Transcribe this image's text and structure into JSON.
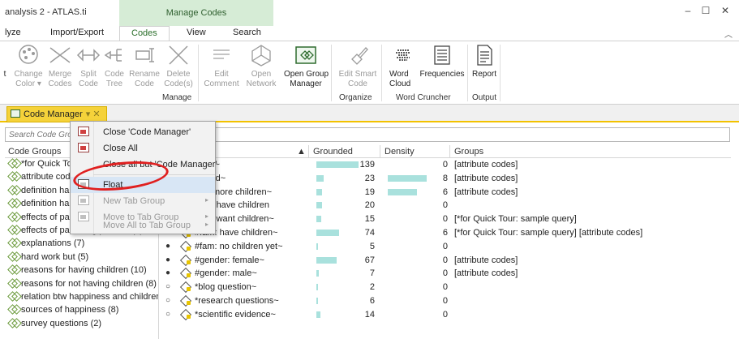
{
  "window": {
    "title": "analysis 2 - ATLAS.ti",
    "context_tab": "Manage Codes",
    "minimize": "–",
    "maximize": "☐",
    "close": "✕"
  },
  "ribbon_tabs": [
    {
      "label": "lyze"
    },
    {
      "label": "Import/Export"
    },
    {
      "label": "Codes"
    },
    {
      "label": "View"
    },
    {
      "label": "Search"
    }
  ],
  "ribbon": {
    "buttons": [
      {
        "label": "t",
        "label2": ""
      },
      {
        "label": "Change",
        "label2": "Color ▾"
      },
      {
        "label": "Merge",
        "label2": "Codes"
      },
      {
        "label": "Split",
        "label2": "Code"
      },
      {
        "label": "Code",
        "label2": "Tree"
      },
      {
        "label": "Rename",
        "label2": "Code"
      },
      {
        "label": "Delete",
        "label2": "Code(s)"
      },
      {
        "label": "Edit",
        "label2": "Comment"
      },
      {
        "label": "Open",
        "label2": "Network"
      },
      {
        "label": "Open Group",
        "label2": "Manager"
      },
      {
        "label": "Edit Smart",
        "label2": "Code"
      },
      {
        "label": "Word",
        "label2": "Cloud"
      },
      {
        "label": "Frequencies",
        "label2": ""
      },
      {
        "label": "Report",
        "label2": ""
      }
    ],
    "groups": [
      "Manage",
      "Organize",
      "Word Cruncher",
      "Output"
    ]
  },
  "doc_tab": {
    "label": "Code Manager",
    "actions": "▾ ✕"
  },
  "search": {
    "placeholder": "Search Code Group"
  },
  "left_pane": {
    "header": "Code Groups",
    "items": [
      "*for Quick Tour",
      "attribute codes",
      "definition happ",
      "definition happ",
      "effects of paren",
      "effects of parenting positive (7)",
      "explanations (7)",
      "hard work but (5)",
      "reasons for having children (10)",
      "reasons for not having children (8)",
      "relation btw happiness and children",
      "sources of happiness (8)",
      "survey questions (2)"
    ]
  },
  "table": {
    "headers": {
      "sort": "▲",
      "grounded": "Grounded",
      "density": "Density",
      "groups": "Groups"
    },
    "rows": [
      {
        "bullet": "",
        "name": "entry~",
        "grounded": 139,
        "gbar": 1.0,
        "density": 0,
        "dbar": 0,
        "groups": "[attribute codes]"
      },
      {
        "bullet": "",
        "name": "1 child~",
        "grounded": 23,
        "gbar": 0.17,
        "density": 8,
        "dbar": 1.0,
        "groups": "[attribute codes]"
      },
      {
        "bullet": "",
        "name": "2 or more  children~",
        "grounded": 19,
        "gbar": 0.14,
        "density": 6,
        "dbar": 0.75,
        "groups": "[attribute codes]"
      },
      {
        "bullet": "",
        "name": "don't have children",
        "grounded": 20,
        "gbar": 0.14,
        "density": 0,
        "dbar": 0,
        "groups": ""
      },
      {
        "bullet": "",
        "name": "don't want children~",
        "grounded": 15,
        "gbar": 0.11,
        "density": 0,
        "dbar": 0,
        "groups": "[*for Quick Tour: sample query]"
      },
      {
        "bullet": "●",
        "name": "#fam: have children~",
        "grounded": 74,
        "gbar": 0.53,
        "density": 6,
        "dbar": 0,
        "groups": "[*for Quick Tour: sample query] [attribute codes]"
      },
      {
        "bullet": "●",
        "name": "#fam: no children yet~",
        "grounded": 5,
        "gbar": 0.04,
        "density": 0,
        "dbar": 0,
        "groups": ""
      },
      {
        "bullet": "●",
        "name": "#gender: female~",
        "grounded": 67,
        "gbar": 0.48,
        "density": 0,
        "dbar": 0,
        "groups": "[attribute codes]"
      },
      {
        "bullet": "●",
        "name": "#gender: male~",
        "grounded": 7,
        "gbar": 0.05,
        "density": 0,
        "dbar": 0,
        "groups": "[attribute codes]"
      },
      {
        "bullet": "○",
        "name": "*blog question~",
        "grounded": 2,
        "gbar": 0.015,
        "density": 0,
        "dbar": 0,
        "groups": ""
      },
      {
        "bullet": "○",
        "name": "*research questions~",
        "grounded": 6,
        "gbar": 0.045,
        "density": 0,
        "dbar": 0,
        "groups": ""
      },
      {
        "bullet": "○",
        "name": "*scientific evidence~",
        "grounded": 14,
        "gbar": 0.1,
        "density": 0,
        "dbar": 0,
        "groups": ""
      }
    ]
  },
  "context_menu": {
    "items": [
      {
        "label": "Close 'Code Manager'",
        "disabled": false
      },
      {
        "label": "Close All",
        "disabled": false
      },
      {
        "label": "Close all but 'Code Manager'",
        "disabled": false
      },
      {
        "label": "Float",
        "disabled": false
      },
      {
        "label": "New Tab Group",
        "disabled": true
      },
      {
        "label": "Move to Tab Group",
        "disabled": true
      },
      {
        "label": "Move All to Tab Group",
        "disabled": true
      }
    ],
    "submenu_arrow": "▸"
  },
  "colors": {
    "bar": "#a9e1dd",
    "doc_tab": "#f5d23a",
    "highlight_ellipse": "#e02020",
    "context_tab": "#d6ecd6"
  }
}
